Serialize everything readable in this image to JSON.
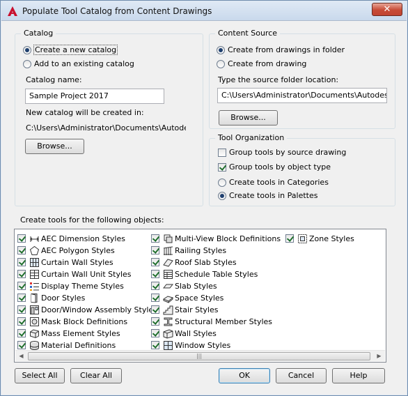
{
  "window": {
    "title": "Populate Tool Catalog from Content Drawings",
    "close_symbol": "✕"
  },
  "catalog": {
    "group_title": "Catalog",
    "create_new_label": "Create a new catalog",
    "add_existing_label": "Add to an existing catalog",
    "selected": "create_new",
    "name_label": "Catalog name:",
    "name_value": "Sample Project 2017",
    "location_label": "New catalog will be created in:",
    "location_value": "C:\\Users\\Administrator\\Documents\\Autodesk\\M",
    "browse_label": "Browse..."
  },
  "content_source": {
    "group_title": "Content Source",
    "from_folder_label": "Create from drawings in folder",
    "from_drawing_label": "Create from drawing",
    "selected": "from_folder",
    "folder_label": "Type the source folder location:",
    "folder_value": "C:\\Users\\Administrator\\Documents\\Autodesk\\My",
    "browse_label": "Browse..."
  },
  "tool_organization": {
    "group_title": "Tool Organization",
    "group_by_source_label": "Group tools by source drawing",
    "group_by_source_checked": false,
    "group_by_type_label": "Group tools by object type",
    "group_by_type_checked": true,
    "in_categories_label": "Create tools in Categories",
    "in_palettes_label": "Create tools in Palettes",
    "selected": "palettes"
  },
  "objects": {
    "label": "Create tools for the following objects:",
    "columns": [
      [
        {
          "label": "AEC Dimension Styles",
          "checked": true,
          "icon": "aec-dimension-icon"
        },
        {
          "label": "AEC Polygon Styles",
          "checked": true,
          "icon": "polygon-icon"
        },
        {
          "label": "Curtain Wall Styles",
          "checked": true,
          "icon": "curtain-wall-icon"
        },
        {
          "label": "Curtain Wall Unit Styles",
          "checked": true,
          "icon": "curtain-wall-unit-icon"
        },
        {
          "label": "Display Theme Styles",
          "checked": true,
          "icon": "display-theme-icon"
        },
        {
          "label": "Door Styles",
          "checked": true,
          "icon": "door-icon"
        },
        {
          "label": "Door/Window Assembly Styles",
          "checked": true,
          "icon": "door-window-assembly-icon"
        },
        {
          "label": "Mask Block Definitions",
          "checked": true,
          "icon": "mask-block-icon"
        },
        {
          "label": "Mass Element Styles",
          "checked": true,
          "icon": "mass-element-icon"
        },
        {
          "label": "Material Definitions",
          "checked": true,
          "icon": "material-icon"
        }
      ],
      [
        {
          "label": "Multi-View Block Definitions",
          "checked": true,
          "icon": "multi-view-block-icon"
        },
        {
          "label": "Railing Styles",
          "checked": true,
          "icon": "railing-icon"
        },
        {
          "label": "Roof Slab Styles",
          "checked": true,
          "icon": "roof-slab-icon"
        },
        {
          "label": "Schedule Table Styles",
          "checked": true,
          "icon": "schedule-table-icon"
        },
        {
          "label": "Slab Styles",
          "checked": true,
          "icon": "slab-icon"
        },
        {
          "label": "Space Styles",
          "checked": true,
          "icon": "space-icon"
        },
        {
          "label": "Stair Styles",
          "checked": true,
          "icon": "stair-icon"
        },
        {
          "label": "Structural Member Styles",
          "checked": true,
          "icon": "structural-member-icon"
        },
        {
          "label": "Wall Styles",
          "checked": true,
          "icon": "wall-icon"
        },
        {
          "label": "Window Styles",
          "checked": true,
          "icon": "window-icon"
        }
      ],
      [
        {
          "label": "Zone Styles",
          "checked": true,
          "icon": "zone-icon"
        }
      ]
    ]
  },
  "scrollbar": {
    "left_arrow": "◀",
    "right_arrow": "▶",
    "grip": "|||"
  },
  "buttons": {
    "select_all": "Select All",
    "clear_all": "Clear All",
    "ok": "OK",
    "cancel": "Cancel",
    "help": "Help"
  },
  "colors": {
    "accent": "#3c7fb1",
    "close_button": "#c74b36",
    "app_logo": "#c8102e"
  }
}
